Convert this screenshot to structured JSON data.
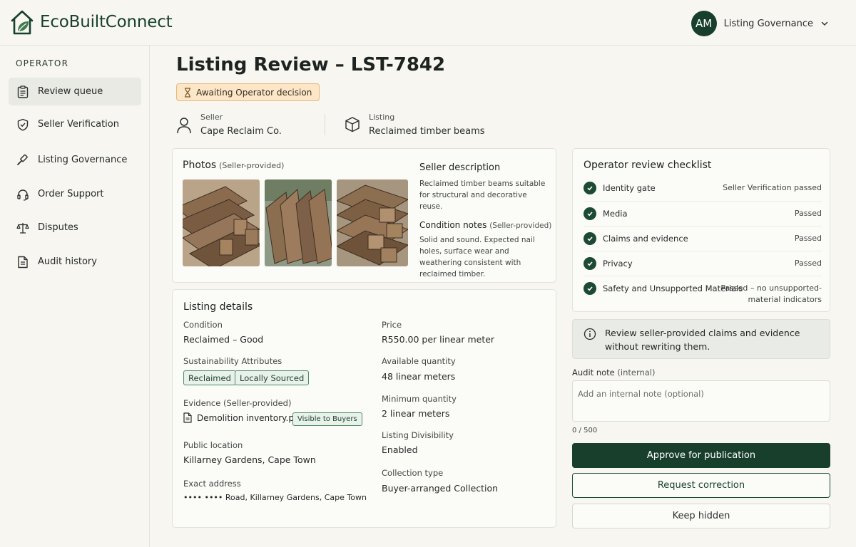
{
  "app": {
    "name": "EcoBuiltConnect"
  },
  "user": {
    "initials": "AM",
    "menu_label": "Listing Governance"
  },
  "sidebar": {
    "section": "OPERATOR",
    "items": [
      {
        "label": "Review queue",
        "icon": "clipboard-icon",
        "active": true
      },
      {
        "label": "Seller Verification",
        "icon": "shield-check-icon"
      },
      {
        "label": "Listing Governance",
        "icon": "gavel-icon"
      },
      {
        "label": "Order Support",
        "icon": "headset-icon"
      },
      {
        "label": "Disputes",
        "icon": "scales-icon"
      },
      {
        "label": "Audit history",
        "icon": "document-icon"
      }
    ]
  },
  "page": {
    "title": "Listing Review – LST-7842",
    "status": "Awaiting Operator decision",
    "seller_label": "Seller",
    "seller_value": "Cape Reclaim Co.",
    "listing_label": "Listing",
    "listing_value": "Reclaimed timber beams"
  },
  "photos": {
    "title": "Photos",
    "subtitle": "(Seller-provided)",
    "desc_title": "Seller description",
    "desc_text": "Reclaimed timber beams suitable for structural and decorative reuse.",
    "cond_title": "Condition notes",
    "cond_subtitle": "(Seller-provided)",
    "cond_text": "Solid and sound. Expected nail holes, surface wear and weathering consistent with reclaimed timber."
  },
  "details": {
    "title": "Listing details",
    "condition_label": "Condition",
    "condition_value": "Reclaimed – Good",
    "sustain_label": "Sustainability Attributes",
    "tags": [
      "Reclaimed",
      "Locally Sourced"
    ],
    "evidence_label": "Evidence (Seller-provided)",
    "evidence_file": "Demolition inventory.pdf",
    "evidence_badge": "Visible to Buyers",
    "location_label": "Public location",
    "location_value": "Killarney Gardens, Cape Town",
    "address_label": "Exact address",
    "address_value": "•••• •••• Road, Killarney Gardens, Cape Town",
    "price_label": "Price",
    "price_value": "R550.00 per linear meter",
    "avail_label": "Available quantity",
    "avail_value": "48 linear meters",
    "min_label": "Minimum quantity",
    "min_value": "2 linear meters",
    "divis_label": "Listing Divisibility",
    "divis_value": "Enabled",
    "collect_label": "Collection type",
    "collect_value": "Buyer-arranged Collection"
  },
  "checklist": {
    "title": "Operator review checklist",
    "items": [
      {
        "name": "Identity gate",
        "status": "Seller Verification passed"
      },
      {
        "name": "Media",
        "status": "Passed"
      },
      {
        "name": "Claims and evidence",
        "status": "Passed"
      },
      {
        "name": "Privacy",
        "status": "Passed"
      },
      {
        "name": "Safety and Unsupported Materials",
        "status_line1": "Passed – no unsupported-",
        "status_line2": "material indicators"
      }
    ]
  },
  "info": {
    "text": "Review seller-provided claims and evidence without rewriting them."
  },
  "audit": {
    "label": "Audit note",
    "label_sub": "(internal)",
    "placeholder": "Add an internal note (optional)",
    "counter": "0 / 500"
  },
  "actions": {
    "approve": "Approve for publication",
    "request": "Request correction",
    "hide": "Keep hidden"
  },
  "colors": {
    "brand": "#173f2c",
    "warning_bg": "#fbe6c8",
    "tag_bg": "#e8f2ea"
  }
}
